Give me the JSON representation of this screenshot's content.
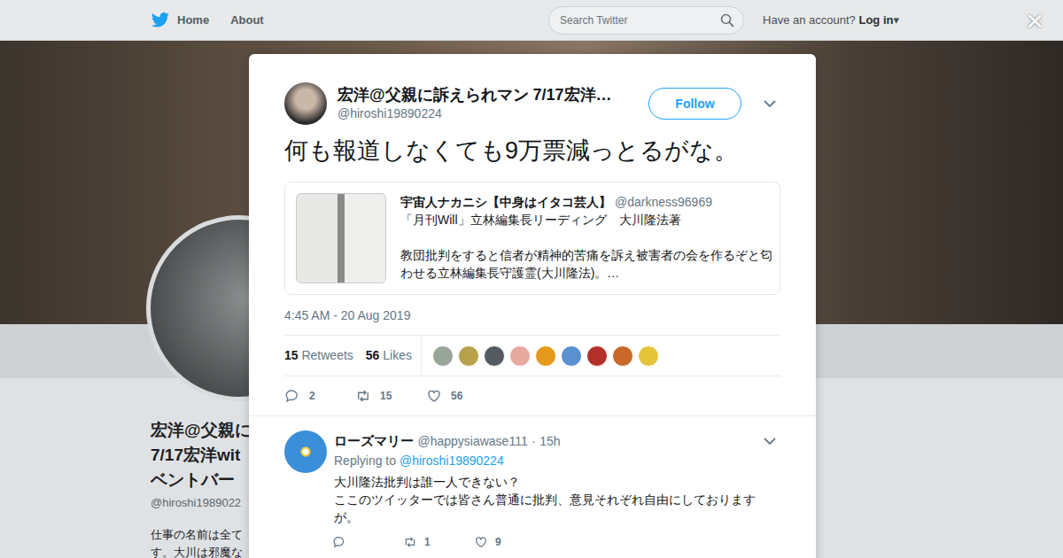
{
  "nav": {
    "links": [
      "Home",
      "About"
    ],
    "search": {
      "placeholder": "Search Twitter"
    },
    "account_prompt": "Have an account?",
    "login": "Log in",
    "login_caret": "▾",
    "close": "×"
  },
  "profile_background": {
    "name_lines": [
      "宏洋@父親に",
      "7/17宏洋wit",
      "ベントバー"
    ],
    "handle": "@hiroshi1989022",
    "bio_lines": [
      "仕事の名前は全て",
      "す。大川は邪魔な"
    ]
  },
  "tweet": {
    "name": "宏洋@父親に訴えられマン 7/17宏洋…",
    "handle": "@hiroshi19890224",
    "follow": "Follow",
    "text": "何も報道しなくても9万票減っとるがな。",
    "quote": {
      "name": "宇宙人ナカニシ【中身はイタコ芸人】",
      "handle": "@darkness96969",
      "lines": [
        "「月刊Will」立林編集長リーディング　大川隆法著",
        "",
        "教団批判をすると信者が精神的苦痛を訴え被害者の会を作るぞと匂",
        "わせる立林編集長守護霊(大川隆法)。…"
      ]
    },
    "time": "4:45 AM - 20 Aug 2019",
    "stats": [
      {
        "count": "15",
        "label": "Retweets"
      },
      {
        "count": "56",
        "label": "Likes"
      }
    ],
    "likers": [
      {
        "color": "#9aa59a"
      },
      {
        "color": "#b7a14a"
      },
      {
        "color": "#555a60"
      },
      {
        "color": "#e7a9a0"
      },
      {
        "color": "#e59a1c"
      },
      {
        "color": "#5a8fd0"
      },
      {
        "color": "#b3302a"
      },
      {
        "color": "#c8692a"
      },
      {
        "color": "#e4c53a"
      }
    ],
    "actions": [
      {
        "kind": "reply",
        "count": "2"
      },
      {
        "kind": "retweet",
        "count": "15"
      },
      {
        "kind": "like",
        "count": "56"
      }
    ]
  },
  "replies": [
    {
      "name": "ローズマリー",
      "handle": "@happysiawase111",
      "separator": "·",
      "time": "15h",
      "replying_label": "Replying to",
      "replying_to": "@hiroshi19890224",
      "lines": [
        "大川隆法批判は誰一人できない？",
        "ここのツイッターでは皆さん普通に批判、意見それぞれ自由にしております",
        "が。"
      ],
      "actions": [
        {
          "kind": "reply"
        },
        {
          "kind": "retweet",
          "count": "1"
        },
        {
          "kind": "like",
          "count": "9"
        }
      ]
    }
  ]
}
